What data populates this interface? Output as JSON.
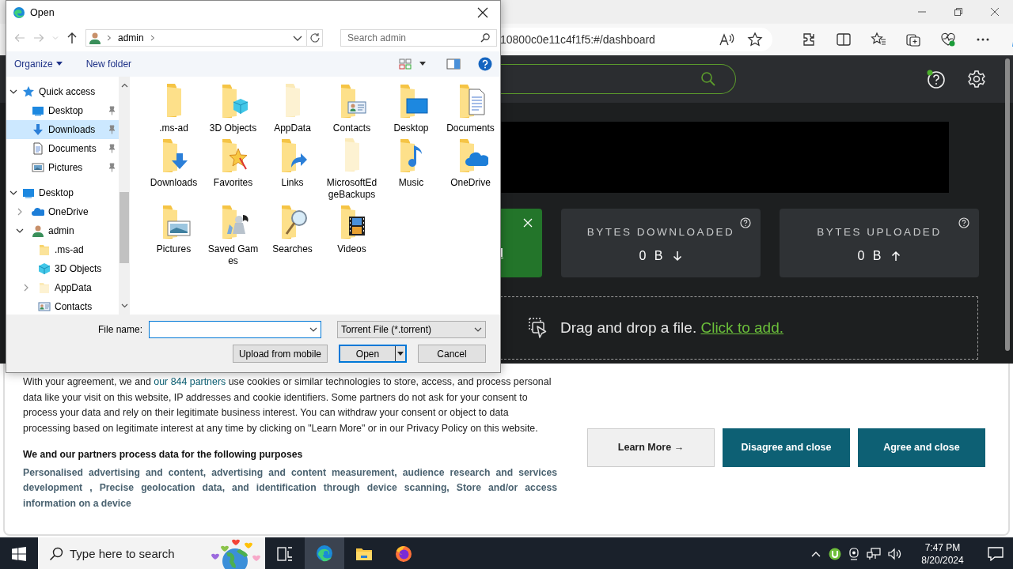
{
  "browser": {
    "address": "10800c0e11c4f1f5:#/dashboard"
  },
  "page": {
    "green_card": {
      "link_fragment": "l"
    },
    "stats": [
      {
        "label": "BYTES DOWNLOADED",
        "value": "0 B",
        "kind": "down"
      },
      {
        "label": "BYTES UPLOADED",
        "value": "0 B",
        "kind": "up"
      }
    ],
    "dropzone": {
      "text": "Drag and drop a file.",
      "link": "Click to add."
    }
  },
  "consent": {
    "text_before": "With your agreement, we and ",
    "link": "our 844 partners",
    "text_after": " use cookies or similar technologies to store, access, and process personal data like your visit on this website, IP addresses and cookie identifiers. Some partners do not ask for your consent to process your data and rely on their legitimate business interest. You can withdraw your consent or object to data processing based on legitimate interest at any time by clicking on \"Learn More\" or in our Privacy Policy on this website.",
    "purposes_title": "We and our partners process data for the following purposes",
    "purposes": "Personalised advertising and content, advertising and content measurement, audience research and services development , Precise geolocation data, and identification through device scanning, Store and/or access information on a device",
    "buttons": [
      {
        "label": "Learn More →",
        "kind": "secondary"
      },
      {
        "label": "Disagree and close",
        "kind": "primary"
      },
      {
        "label": "Agree and close",
        "kind": "primary"
      }
    ]
  },
  "dialog": {
    "title": "Open",
    "path": [
      "admin"
    ],
    "search_placeholder": "Search admin",
    "organize": "Organize",
    "new_folder": "New folder",
    "tree": [
      {
        "label": "Quick access",
        "kind": "star",
        "expanded": true,
        "selected": false,
        "children": [
          {
            "label": "Desktop",
            "kind": "desktop",
            "pinned": true,
            "selected": false
          },
          {
            "label": "Downloads",
            "kind": "download",
            "pinned": true,
            "selected": true
          },
          {
            "label": "Documents",
            "kind": "document",
            "pinned": true,
            "selected": false
          },
          {
            "label": "Pictures",
            "kind": "picture",
            "pinned": true,
            "selected": false
          }
        ]
      },
      {
        "label": "Desktop",
        "kind": "desktop",
        "expanded": true,
        "selected": false,
        "children": [
          {
            "label": "OneDrive",
            "kind": "cloud",
            "expanded": false,
            "selected": false
          },
          {
            "label": "admin",
            "kind": "user",
            "expanded": true,
            "selected": false,
            "children": [
              {
                "label": ".ms-ad",
                "kind": "folder",
                "selected": false
              },
              {
                "label": "3D Objects",
                "kind": "cube",
                "selected": false
              },
              {
                "label": "AppData",
                "kind": "faded",
                "expanded": false,
                "selected": false
              },
              {
                "label": "Contacts",
                "kind": "contacts",
                "selected": false
              }
            ]
          }
        ]
      }
    ],
    "items": [
      {
        "label": ".ms-ad",
        "kind": "plain"
      },
      {
        "label": "3D Objects",
        "kind": "cube"
      },
      {
        "label": "AppData",
        "kind": "faded"
      },
      {
        "label": "Contacts",
        "kind": "contacts"
      },
      {
        "label": "Desktop",
        "kind": "desktop"
      },
      {
        "label": "Documents",
        "kind": "document"
      },
      {
        "label": "Downloads",
        "kind": "download"
      },
      {
        "label": "Favorites",
        "kind": "star"
      },
      {
        "label": "Links",
        "kind": "link"
      },
      {
        "label": "MicrosoftEdgeBackups",
        "kind": "faded"
      },
      {
        "label": "Music",
        "kind": "music"
      },
      {
        "label": "OneDrive",
        "kind": "cloud"
      },
      {
        "label": "Pictures",
        "kind": "picture"
      },
      {
        "label": "Saved Games",
        "kind": "games"
      },
      {
        "label": "Searches",
        "kind": "search"
      },
      {
        "label": "Videos",
        "kind": "video"
      }
    ],
    "file_name_label": "File name:",
    "file_type": "Torrent File (*.torrent)",
    "buttons": [
      {
        "label": "Upload from mobile",
        "kind": "plain"
      },
      {
        "label": "Open",
        "kind": "split"
      },
      {
        "label": "Cancel",
        "kind": "plain"
      }
    ]
  },
  "taskbar": {
    "search_placeholder": "Type here to search",
    "apps": [
      {
        "kind": "edge",
        "selected": true
      },
      {
        "kind": "explorer",
        "selected": false
      },
      {
        "kind": "firefox",
        "selected": false
      }
    ],
    "time": "7:47 PM",
    "date": "8/20/2024"
  }
}
